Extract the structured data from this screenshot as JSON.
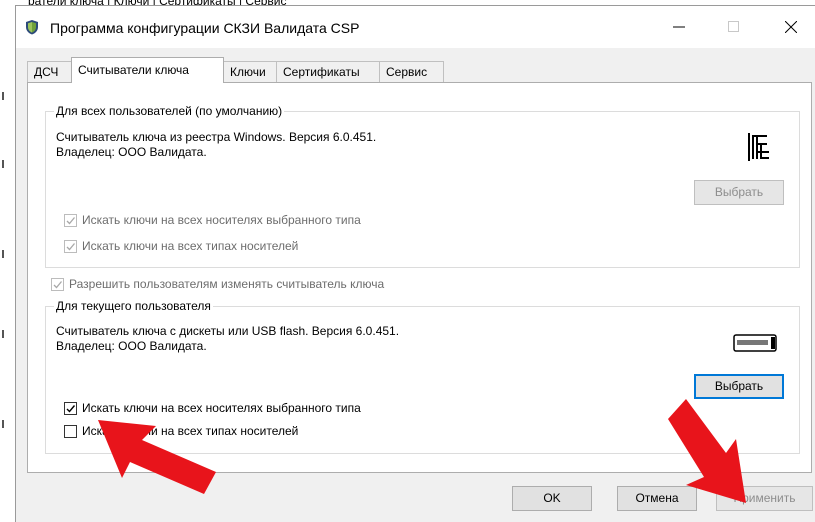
{
  "background_text": "ратели ключа  |  Ключи  |  Сертификаты  |  Сервис",
  "window": {
    "title": "Программа конфигурации СКЗИ Валидата CSP",
    "controls": {
      "minimize": "—",
      "maximize": "☐",
      "close": "✕"
    }
  },
  "tabs": [
    {
      "label": "ДСЧ"
    },
    {
      "label": "Считыватели ключа",
      "active": true
    },
    {
      "label": "Ключи"
    },
    {
      "label": "Сертификаты"
    },
    {
      "label": "Сервис"
    }
  ],
  "all_users": {
    "legend": "Для всех пользователей (по умолчанию)",
    "reader_line1": "Считыватель ключа из реестра Windows. Версия 6.0.451.",
    "reader_line2": "Владелец: ООО Валидата.",
    "icon": "registry-tree-icon",
    "select_button": "Выбрать",
    "select_enabled": false,
    "checkboxes": [
      {
        "label": "Искать ключи на всех носителях выбранного типа",
        "checked": true,
        "enabled": false
      },
      {
        "label": "Искать ключи на всех типах носителей",
        "checked": true,
        "enabled": false
      }
    ]
  },
  "allow_users_change": {
    "label": "Разрешить пользователям изменять считыватель ключа",
    "checked": true,
    "enabled": false
  },
  "current_user": {
    "legend": "Для текущего пользователя",
    "reader_line1": "Считыватель ключа с дискеты или USB flash. Версия 6.0.451.",
    "reader_line2": "Владелец: ООО Валидата.",
    "icon": "usb-drive-icon",
    "select_button": "Выбрать",
    "select_enabled": true,
    "checkboxes": [
      {
        "label": "Искать ключи на всех носителях выбранного типа",
        "checked": true,
        "enabled": true
      },
      {
        "label": "Искать ключи на всех типах носителей",
        "checked": false,
        "enabled": true
      }
    ]
  },
  "footer": {
    "ok": "OK",
    "cancel": "Отмена",
    "apply": "Применить",
    "apply_enabled": false
  },
  "annotations": {
    "arrow_color": "#e8141b"
  }
}
